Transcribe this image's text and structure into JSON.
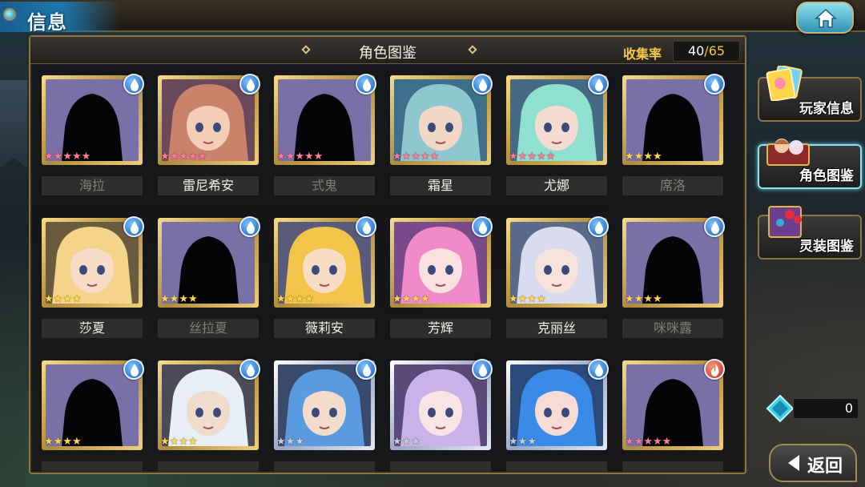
{
  "header": {
    "title": "信息",
    "home_icon": "home-icon"
  },
  "panel": {
    "title": "角色图鉴",
    "collection_label": "收集率",
    "collection_count": "40",
    "collection_separator": "/",
    "collection_total": "65"
  },
  "characters": [
    {
      "name": "海拉",
      "unlocked": false,
      "stars": 5,
      "star_color": "pink",
      "element": "water",
      "art": "silhouette"
    },
    {
      "name": "雷尼希安",
      "unlocked": true,
      "stars": 5,
      "star_color": "pink",
      "element": "water",
      "art": "brown"
    },
    {
      "name": "式鬼",
      "unlocked": false,
      "stars": 5,
      "star_color": "pink",
      "element": "water",
      "art": "silhouette"
    },
    {
      "name": "霜星",
      "unlocked": true,
      "stars": 5,
      "star_color": "pink",
      "element": "water",
      "art": "teal"
    },
    {
      "name": "尤娜",
      "unlocked": true,
      "stars": 5,
      "star_color": "pink",
      "element": "water",
      "art": "mint"
    },
    {
      "name": "席洛",
      "unlocked": false,
      "stars": 4,
      "star_color": "yellow",
      "element": "water",
      "art": "silhouette"
    },
    {
      "name": "莎夏",
      "unlocked": true,
      "stars": 4,
      "star_color": "yellow",
      "element": "water",
      "art": "blonde"
    },
    {
      "name": "丝拉夏",
      "unlocked": false,
      "stars": 4,
      "star_color": "yellow",
      "element": "water",
      "art": "silhouette"
    },
    {
      "name": "薇莉安",
      "unlocked": true,
      "stars": 4,
      "star_color": "yellow",
      "element": "water",
      "art": "gold"
    },
    {
      "name": "芳辉",
      "unlocked": true,
      "stars": 4,
      "star_color": "yellow",
      "element": "water",
      "art": "pink"
    },
    {
      "name": "克丽丝",
      "unlocked": true,
      "stars": 4,
      "star_color": "yellow",
      "element": "water",
      "art": "silver"
    },
    {
      "name": "咪咪露",
      "unlocked": false,
      "stars": 4,
      "star_color": "yellow",
      "element": "water",
      "art": "silhouette"
    },
    {
      "name": "",
      "unlocked": false,
      "stars": 4,
      "star_color": "yellow",
      "element": "water",
      "art": "silhouette"
    },
    {
      "name": "",
      "unlocked": true,
      "stars": 4,
      "star_color": "yellow",
      "element": "water",
      "art": "white"
    },
    {
      "name": "",
      "unlocked": true,
      "stars": 3,
      "star_color": "silver",
      "element": "water",
      "art": "blue"
    },
    {
      "name": "",
      "unlocked": true,
      "stars": 3,
      "star_color": "silver",
      "element": "water",
      "art": "lilac"
    },
    {
      "name": "",
      "unlocked": true,
      "stars": 3,
      "star_color": "silver",
      "element": "water",
      "art": "azure"
    },
    {
      "name": "",
      "unlocked": false,
      "stars": 5,
      "star_color": "pink",
      "element": "fire",
      "art": "silhouette"
    }
  ],
  "sidebar": {
    "items": [
      {
        "label": "玩家信息",
        "icon": "player-card-icon"
      },
      {
        "label": "角色图鉴",
        "icon": "character-book-icon"
      },
      {
        "label": "灵装图鉴",
        "icon": "equipment-book-icon"
      }
    ]
  },
  "currency": {
    "count": "0",
    "icon": "gem-icon"
  },
  "footer": {
    "back_label": "返回",
    "back_icon": "back-arrow-icon"
  },
  "colors": {
    "gold_accent": "#f6c84a",
    "water_element": "#1258b8",
    "fire_element": "#b2281a",
    "active_menu_glow": "#5fd6ef"
  }
}
